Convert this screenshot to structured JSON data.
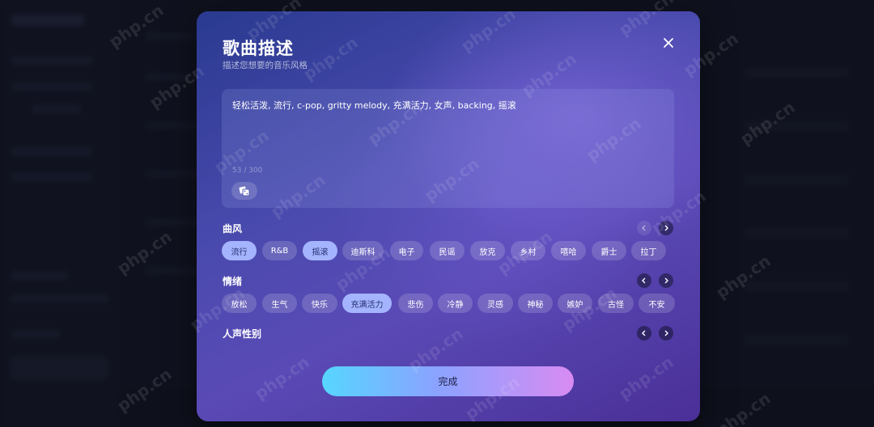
{
  "modal": {
    "title": "歌曲描述",
    "subtitle": "描述您想要的音乐风格",
    "description": "轻松活泼, 流行, c-pop, gritty melody, 充满活力, 女声, backing, 摇滚",
    "char_count": "53 / 300",
    "done_label": "完成"
  },
  "sections": {
    "genre": {
      "label": "曲风",
      "tags": [
        "流行",
        "R&B",
        "摇滚",
        "迪斯科",
        "电子",
        "民谣",
        "放克",
        "乡村",
        "嘻哈",
        "爵士",
        "拉丁"
      ],
      "selected": [
        "流行",
        "摇滚"
      ]
    },
    "mood": {
      "label": "情绪",
      "tags": [
        "放松",
        "生气",
        "快乐",
        "充满活力",
        "悲伤",
        "冷静",
        "灵感",
        "神秘",
        "嫉妒",
        "古怪",
        "不安"
      ],
      "selected": [
        "充满活力"
      ]
    },
    "vocal": {
      "label": "人声性别"
    }
  },
  "watermark": "php.cn"
}
